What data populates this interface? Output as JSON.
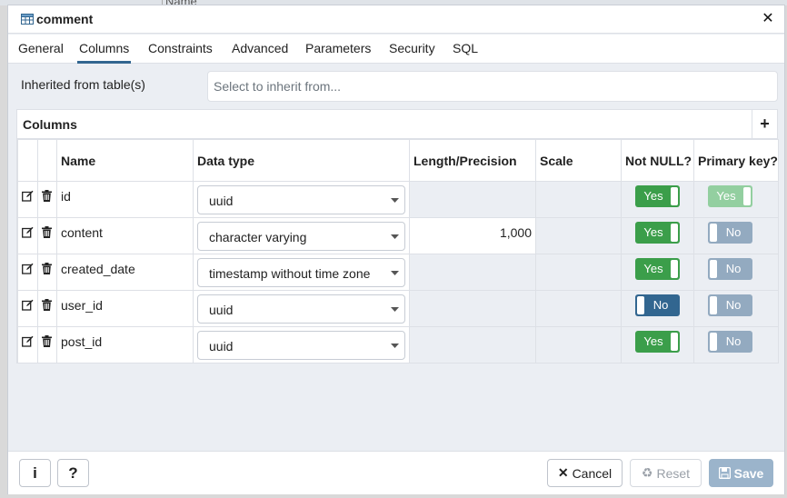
{
  "background": {
    "partial_header": "Name"
  },
  "dialog": {
    "title": "comment",
    "title_icon": "table-icon",
    "close_icon": "close-icon"
  },
  "tabs": [
    {
      "label": "General",
      "active": false
    },
    {
      "label": "Columns",
      "active": true
    },
    {
      "label": "Constraints",
      "active": false
    },
    {
      "label": "Advanced",
      "active": false
    },
    {
      "label": "Parameters",
      "active": false
    },
    {
      "label": "Security",
      "active": false
    },
    {
      "label": "SQL",
      "active": false
    }
  ],
  "inherit": {
    "label": "Inherited from table(s)",
    "placeholder": "Select to inherit from..."
  },
  "columns_grid": {
    "title": "Columns",
    "add_icon": "plus-icon",
    "headers": {
      "name": "Name",
      "data_type": "Data type",
      "length": "Length/Precision",
      "scale": "Scale",
      "not_null": "Not NULL?",
      "primary_key": "Primary key?"
    },
    "rows": [
      {
        "name": "id",
        "data_type": "uuid",
        "length": "",
        "scale": "",
        "not_null": {
          "label": "Yes",
          "on": true
        },
        "primary_key": {
          "label": "Yes",
          "on": true,
          "disabled": true
        }
      },
      {
        "name": "content",
        "data_type": "character varying",
        "length": "1,000",
        "scale": "",
        "not_null": {
          "label": "Yes",
          "on": true
        },
        "primary_key": {
          "label": "No",
          "on": false
        }
      },
      {
        "name": "created_date",
        "data_type": "timestamp without time zone",
        "length": "",
        "scale": "",
        "not_null": {
          "label": "Yes",
          "on": true
        },
        "primary_key": {
          "label": "No",
          "on": false
        }
      },
      {
        "name": "user_id",
        "data_type": "uuid",
        "length": "",
        "scale": "",
        "not_null": {
          "label": "No",
          "on": false
        },
        "primary_key": {
          "label": "No",
          "on": false
        }
      },
      {
        "name": "post_id",
        "data_type": "uuid",
        "length": "",
        "scale": "",
        "not_null": {
          "label": "Yes",
          "on": true
        },
        "primary_key": {
          "label": "No",
          "on": false
        }
      }
    ]
  },
  "footer": {
    "info_label": "i",
    "help_label": "?",
    "cancel_label": "Cancel",
    "reset_label": "Reset",
    "save_label": "Save"
  },
  "colors": {
    "toggle_on": "#3b9e4a",
    "toggle_off": "#326690",
    "toggle_off_muted": "#93aac0",
    "save_disabled": "#9bb4cb",
    "accent": "#326690"
  }
}
